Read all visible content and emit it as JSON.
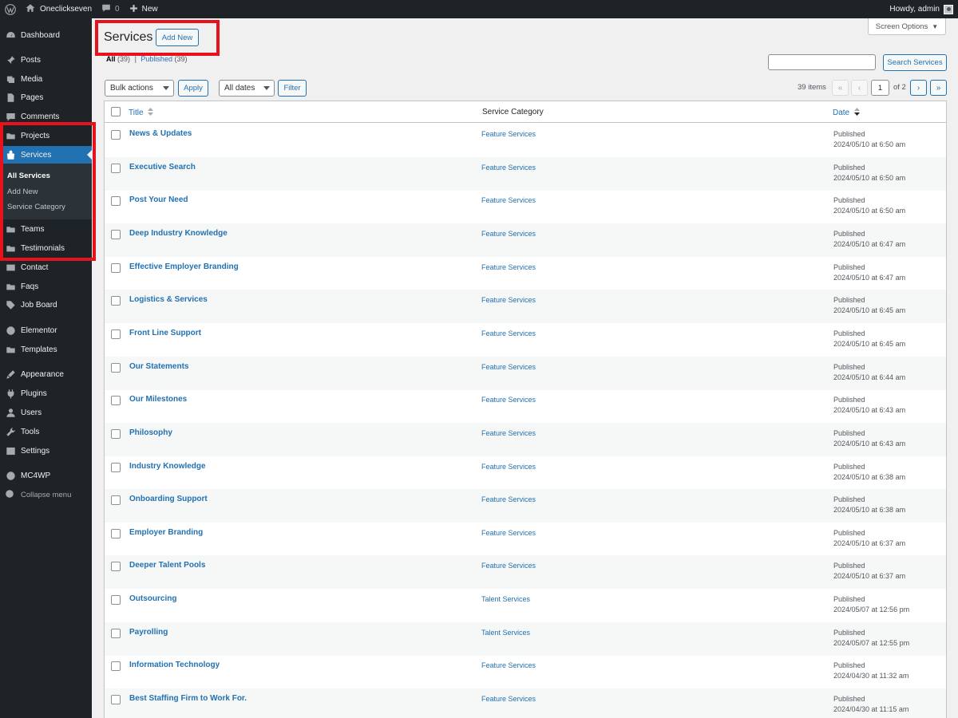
{
  "admin_bar": {
    "site_name": "Oneclickseven",
    "comments_count": "0",
    "new_label": "New",
    "howdy": "Howdy, admin"
  },
  "sidebar": {
    "items": [
      {
        "label": "Dashboard",
        "icon": "dashboard-icon"
      },
      {
        "label": "Posts",
        "icon": "pin-icon"
      },
      {
        "label": "Media",
        "icon": "media-icon"
      },
      {
        "label": "Pages",
        "icon": "page-icon"
      },
      {
        "label": "Comments",
        "icon": "comment-icon"
      },
      {
        "label": "Projects",
        "icon": "folder-icon"
      },
      {
        "label": "Services",
        "icon": "bag-icon"
      },
      {
        "label": "Teams",
        "icon": "folder-icon"
      },
      {
        "label": "Testimonials",
        "icon": "folder-icon"
      },
      {
        "label": "Contact",
        "icon": "mail-icon"
      },
      {
        "label": "Faqs",
        "icon": "folder-icon"
      },
      {
        "label": "Job Board",
        "icon": "tag-icon"
      },
      {
        "label": "Elementor",
        "icon": "elementor-icon"
      },
      {
        "label": "Templates",
        "icon": "folder-icon"
      },
      {
        "label": "Appearance",
        "icon": "brush-icon"
      },
      {
        "label": "Plugins",
        "icon": "plug-icon"
      },
      {
        "label": "Users",
        "icon": "user-icon"
      },
      {
        "label": "Tools",
        "icon": "wrench-icon"
      },
      {
        "label": "Settings",
        "icon": "settings-icon"
      },
      {
        "label": "MC4WP",
        "icon": "mc4wp-icon"
      }
    ],
    "submenu": [
      "All Services",
      "Add New",
      "Service Category"
    ],
    "collapse_label": "Collapse menu"
  },
  "header": {
    "title": "Services",
    "add_new": "Add New",
    "screen_options": "Screen Options",
    "filter_all": "All",
    "filter_all_count": "(39)",
    "filter_separator": "|",
    "filter_published": "Published",
    "filter_published_count": "(39)",
    "search_button": "Search Services"
  },
  "toolbar": {
    "bulk_actions": "Bulk actions",
    "apply": "Apply",
    "all_dates": "All dates",
    "filter": "Filter",
    "items_count": "39 items",
    "first_page": "«",
    "prev_page": "‹",
    "current_page": "1",
    "of_pages": "of 2",
    "next_page": "›",
    "last_page": "»"
  },
  "table": {
    "columns": [
      "Title",
      "Service Category",
      "Date"
    ],
    "rows": [
      {
        "title": "News & Updates",
        "category": "Feature Services",
        "status": "Published",
        "date": "2024/05/10 at 6:50 am"
      },
      {
        "title": "Executive Search",
        "category": "Feature Services",
        "status": "Published",
        "date": "2024/05/10 at 6:50 am"
      },
      {
        "title": "Post Your Need",
        "category": "Feature Services",
        "status": "Published",
        "date": "2024/05/10 at 6:50 am"
      },
      {
        "title": "Deep Industry Knowledge",
        "category": "Feature Services",
        "status": "Published",
        "date": "2024/05/10 at 6:47 am"
      },
      {
        "title": "Effective Employer Branding",
        "category": "Feature Services",
        "status": "Published",
        "date": "2024/05/10 at 6:47 am"
      },
      {
        "title": "Logistics & Services",
        "category": "Feature Services",
        "status": "Published",
        "date": "2024/05/10 at 6:45 am"
      },
      {
        "title": "Front Line Support",
        "category": "Feature Services",
        "status": "Published",
        "date": "2024/05/10 at 6:45 am"
      },
      {
        "title": "Our Statements",
        "category": "Feature Services",
        "status": "Published",
        "date": "2024/05/10 at 6:44 am"
      },
      {
        "title": "Our Milestones",
        "category": "Feature Services",
        "status": "Published",
        "date": "2024/05/10 at 6:43 am"
      },
      {
        "title": "Philosophy",
        "category": "Feature Services",
        "status": "Published",
        "date": "2024/05/10 at 6:43 am"
      },
      {
        "title": "Industry Knowledge",
        "category": "Feature Services",
        "status": "Published",
        "date": "2024/05/10 at 6:38 am"
      },
      {
        "title": "Onboarding Support",
        "category": "Feature Services",
        "status": "Published",
        "date": "2024/05/10 at 6:38 am"
      },
      {
        "title": "Employer Branding",
        "category": "Feature Services",
        "status": "Published",
        "date": "2024/05/10 at 6:37 am"
      },
      {
        "title": "Deeper Talent Pools",
        "category": "Feature Services",
        "status": "Published",
        "date": "2024/05/10 at 6:37 am"
      },
      {
        "title": "Outsourcing",
        "category": "Talent Services",
        "status": "Published",
        "date": "2024/05/07 at 12:56 pm"
      },
      {
        "title": "Payrolling",
        "category": "Talent Services",
        "status": "Published",
        "date": "2024/05/07 at 12:55 pm"
      },
      {
        "title": "Information Technology",
        "category": "Feature Services",
        "status": "Published",
        "date": "2024/04/30 at 11:32 am"
      },
      {
        "title": "Best Staffing Firm to Work For.",
        "category": "Feature Services",
        "status": "Published",
        "date": "2024/04/30 at 11:15 am"
      }
    ]
  },
  "colors": {
    "admin_dark": "#1d2327",
    "accent": "#2271b1",
    "highlight": "#e8121d"
  }
}
